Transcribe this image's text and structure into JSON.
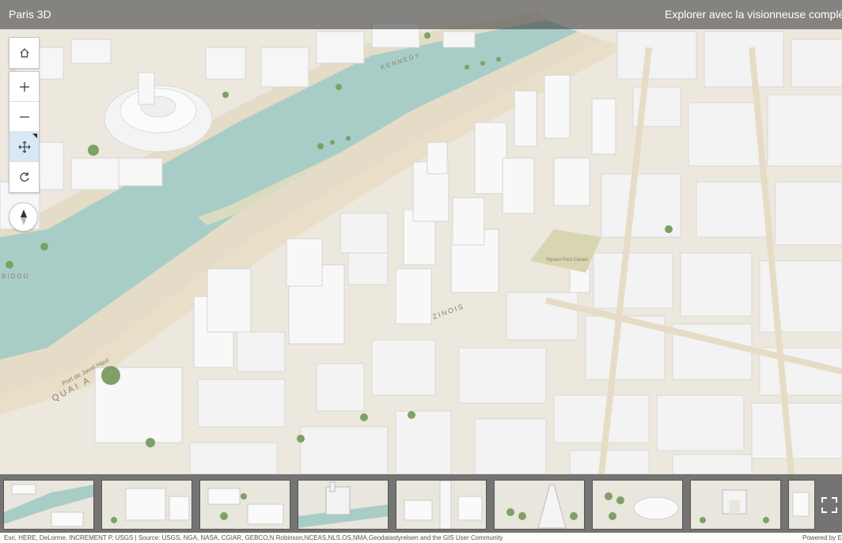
{
  "header": {
    "title": "Paris 3D",
    "link_text": "Explorer avec la visionneuse complète"
  },
  "navigation": {
    "buttons": [
      {
        "name": "home",
        "icon": "home-icon"
      },
      {
        "name": "zoom-in",
        "icon": "plus-icon"
      },
      {
        "name": "zoom-out",
        "icon": "minus-icon"
      },
      {
        "name": "pan",
        "icon": "pan-arrows-icon",
        "active": true
      },
      {
        "name": "rotate",
        "icon": "rotate-icon"
      }
    ],
    "compass_icon": "compass-icon"
  },
  "map": {
    "labels": {
      "quai_1": "QUAI A",
      "port": "Port de Javel Haut",
      "square": "Square Paul Casals",
      "rue": "ZINOIS",
      "kennedy": "KENNEDY",
      "bidou": "BIDOU"
    },
    "colors": {
      "water": "#a8cdc6",
      "ground": "#ece8de",
      "road": "#e6dcc8",
      "building": "#f7f7f7",
      "tree": "#7fa066"
    }
  },
  "slides": {
    "count": 9,
    "fullscreen_icon": "fullscreen-icon"
  },
  "attribution": {
    "text": "Esri, HERE, DeLorme, INCREMENT P, USGS | Source: USGS, NGA, NASA, CGIAR, GEBCO,N Robinson,NCEAS,NLS,OS,NMA,Geodatastyrelsen and the GIS User Community",
    "powered_by": "Powered by Esri"
  }
}
